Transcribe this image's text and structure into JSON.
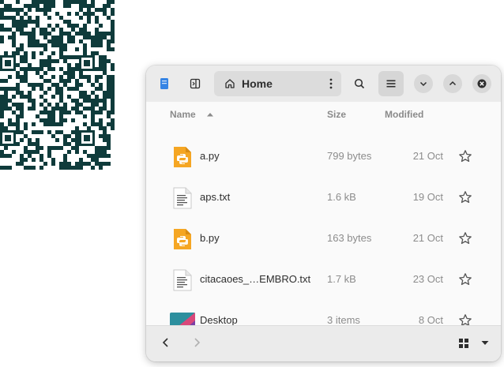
{
  "window": {
    "location_label": "Home",
    "columns": {
      "name": "Name",
      "size": "Size",
      "modified": "Modified"
    },
    "files": [
      {
        "name": "a.py",
        "size": "799 bytes",
        "modified": "21 Oct",
        "icon": "python-file-icon"
      },
      {
        "name": "aps.txt",
        "size": "1.6 kB",
        "modified": "19 Oct",
        "icon": "text-file-icon"
      },
      {
        "name": "b.py",
        "size": "163 bytes",
        "modified": "21 Oct",
        "icon": "python-file-icon"
      },
      {
        "name": "citacaoes_…EMBRO.txt",
        "size": "1.7 kB",
        "modified": "23 Oct",
        "icon": "text-file-icon"
      },
      {
        "name": "Desktop",
        "size": "3 items",
        "modified": "8 Oct",
        "icon": "desktop-folder-icon"
      }
    ]
  },
  "colors": {
    "accent": "#3584e4",
    "python": "#f5a623",
    "text": "#2e2e2e",
    "muted": "#8c8c8c"
  }
}
